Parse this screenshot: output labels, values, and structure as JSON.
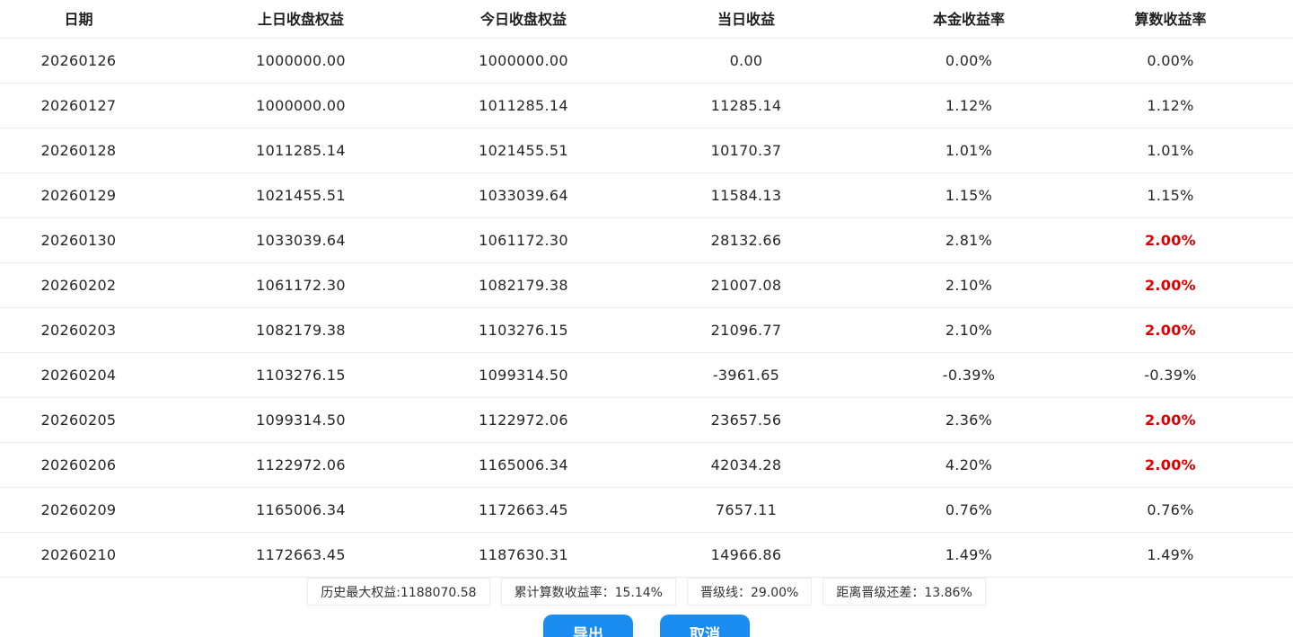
{
  "table": {
    "headers": [
      "日期",
      "上日收盘权益",
      "今日收盘权益",
      "当日收益",
      "本金收益率",
      "算数收益率"
    ],
    "rows": [
      {
        "date": "20260126",
        "prev_equity": "1000000.00",
        "today_equity": "1000000.00",
        "daily_profit": "0.00",
        "principal_rate": "0.00%",
        "arith_rate": "0.00%",
        "arith_highlight": false
      },
      {
        "date": "20260127",
        "prev_equity": "1000000.00",
        "today_equity": "1011285.14",
        "daily_profit": "11285.14",
        "principal_rate": "1.12%",
        "arith_rate": "1.12%",
        "arith_highlight": false
      },
      {
        "date": "20260128",
        "prev_equity": "1011285.14",
        "today_equity": "1021455.51",
        "daily_profit": "10170.37",
        "principal_rate": "1.01%",
        "arith_rate": "1.01%",
        "arith_highlight": false
      },
      {
        "date": "20260129",
        "prev_equity": "1021455.51",
        "today_equity": "1033039.64",
        "daily_profit": "11584.13",
        "principal_rate": "1.15%",
        "arith_rate": "1.15%",
        "arith_highlight": false
      },
      {
        "date": "20260130",
        "prev_equity": "1033039.64",
        "today_equity": "1061172.30",
        "daily_profit": "28132.66",
        "principal_rate": "2.81%",
        "arith_rate": "2.00%",
        "arith_highlight": true
      },
      {
        "date": "20260202",
        "prev_equity": "1061172.30",
        "today_equity": "1082179.38",
        "daily_profit": "21007.08",
        "principal_rate": "2.10%",
        "arith_rate": "2.00%",
        "arith_highlight": true
      },
      {
        "date": "20260203",
        "prev_equity": "1082179.38",
        "today_equity": "1103276.15",
        "daily_profit": "21096.77",
        "principal_rate": "2.10%",
        "arith_rate": "2.00%",
        "arith_highlight": true
      },
      {
        "date": "20260204",
        "prev_equity": "1103276.15",
        "today_equity": "1099314.50",
        "daily_profit": "-3961.65",
        "principal_rate": "-0.39%",
        "arith_rate": "-0.39%",
        "arith_highlight": false
      },
      {
        "date": "20260205",
        "prev_equity": "1099314.50",
        "today_equity": "1122972.06",
        "daily_profit": "23657.56",
        "principal_rate": "2.36%",
        "arith_rate": "2.00%",
        "arith_highlight": true
      },
      {
        "date": "20260206",
        "prev_equity": "1122972.06",
        "today_equity": "1165006.34",
        "daily_profit": "42034.28",
        "principal_rate": "4.20%",
        "arith_rate": "2.00%",
        "arith_highlight": true
      },
      {
        "date": "20260209",
        "prev_equity": "1165006.34",
        "today_equity": "1172663.45",
        "daily_profit": "7657.11",
        "principal_rate": "0.76%",
        "arith_rate": "0.76%",
        "arith_highlight": false
      },
      {
        "date": "20260210",
        "prev_equity": "1172663.45",
        "today_equity": "1187630.31",
        "daily_profit": "14966.86",
        "principal_rate": "1.49%",
        "arith_rate": "1.49%",
        "arith_highlight": false
      }
    ]
  },
  "summary": {
    "max_equity": "历史最大权益:1188070.58",
    "cumulative_rate": "累计算数收益率：15.14%",
    "promotion_line": "晋级线：29.00%",
    "remaining_gap": "距离晋级还差：13.86%"
  },
  "buttons": {
    "export_label": "导出",
    "cancel_label": "取消"
  },
  "colors": {
    "accent": "#1a8cf0",
    "highlight": "#e00000",
    "divider": "#ececec"
  }
}
